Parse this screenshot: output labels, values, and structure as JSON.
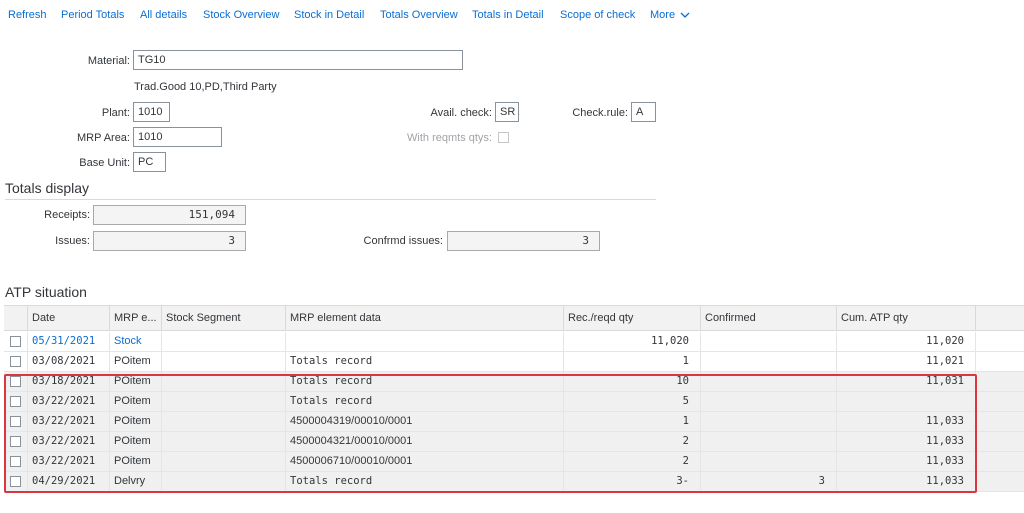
{
  "toolbar": {
    "items": [
      "Refresh",
      "Period Totals",
      "All details",
      "Stock Overview",
      "Stock in Detail",
      "Totals Overview",
      "Totals in Detail",
      "Scope of check",
      "More"
    ],
    "more_chevron": "chevron-down-icon"
  },
  "header": {
    "material_label": "Material:",
    "material_value": "TG10",
    "material_desc": "Trad.Good 10,PD,Third Party",
    "plant_label": "Plant:",
    "plant_value": "1010",
    "mrp_area_label": "MRP Area:",
    "mrp_area_value": "1010",
    "base_unit_label": "Base Unit:",
    "base_unit_value": "PC",
    "avail_check_label": "Avail. check:",
    "avail_check_value": "SR",
    "check_rule_label": "Check.rule:",
    "check_rule_value": "A",
    "with_reqmts_label": "With reqmts qtys:"
  },
  "totals": {
    "title": "Totals display",
    "receipts_label": "Receipts:",
    "receipts_value": "151,094",
    "issues_label": "Issues:",
    "issues_value": "3",
    "confirmed_issues_label": "Confrmd issues:",
    "confirmed_issues_value": "3"
  },
  "atp": {
    "title": "ATP situation",
    "columns": [
      "Date",
      "MRP e...",
      "Stock Segment",
      "MRP element data",
      "Rec./reqd qty",
      "Confirmed",
      "Cum. ATP qty"
    ],
    "rows": [
      {
        "date": "05/31/2021",
        "mrp": "Stock",
        "segment": "",
        "data": "",
        "qty": "11,020",
        "confirmed": "",
        "cum": "11,020"
      },
      {
        "date": "03/08/2021",
        "mrp": "POitem",
        "segment": "",
        "data": "Totals record",
        "qty": "1",
        "confirmed": "",
        "cum": "11,021"
      },
      {
        "date": "03/18/2021",
        "mrp": "POitem",
        "segment": "",
        "data": "Totals record",
        "qty": "10",
        "confirmed": "",
        "cum": "11,031"
      },
      {
        "date": "03/22/2021",
        "mrp": "POitem",
        "segment": "",
        "data": "Totals record",
        "qty": "5",
        "confirmed": "",
        "cum": ""
      },
      {
        "date": "03/22/2021",
        "mrp": "POitem",
        "segment": "",
        "data": "4500004319/00010/0001",
        "qty": "1",
        "confirmed": "",
        "cum": "11,033"
      },
      {
        "date": "03/22/2021",
        "mrp": "POitem",
        "segment": "",
        "data": "4500004321/00010/0001",
        "qty": "2",
        "confirmed": "",
        "cum": "11,033"
      },
      {
        "date": "03/22/2021",
        "mrp": "POitem",
        "segment": "",
        "data": "4500006710/00010/0001",
        "qty": "2",
        "confirmed": "",
        "cum": "11,033"
      },
      {
        "date": "04/29/2021",
        "mrp": "Delvry",
        "segment": "",
        "data": "Totals record",
        "qty": "3-",
        "confirmed": "3",
        "cum": "11,033"
      }
    ]
  },
  "colors": {
    "link": "#0a6ed1",
    "highlight_border": "#d9363e"
  }
}
